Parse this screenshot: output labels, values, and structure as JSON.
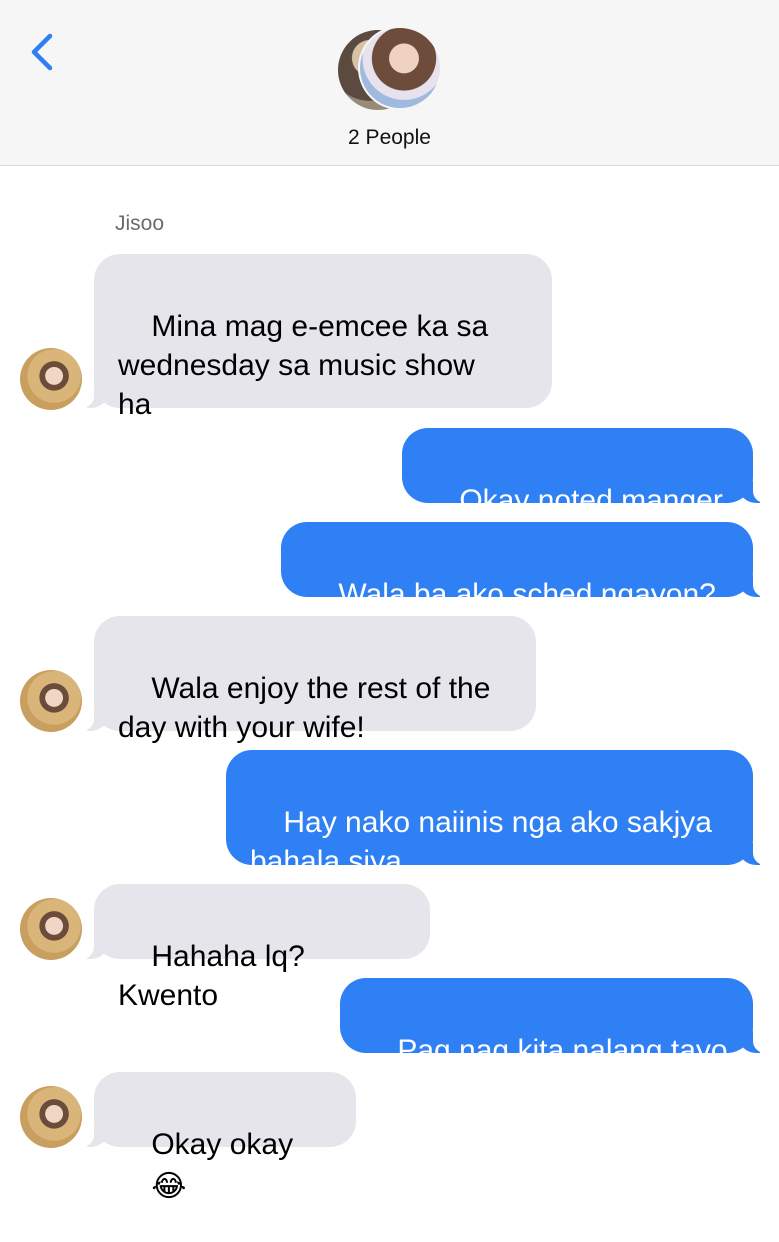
{
  "header": {
    "title": "2 People",
    "back_icon": "chevron-left-icon",
    "accent_color": "#2f80f4"
  },
  "thread": {
    "sender_name": "Jisoo",
    "messages": [
      {
        "direction": "in",
        "text": "Mina mag e-emcee ka sa\nwednesday sa music show\nha"
      },
      {
        "direction": "out",
        "text": "Okay noted manger"
      },
      {
        "direction": "out",
        "text": "Wala ba ako sched ngayon?"
      },
      {
        "direction": "in",
        "text": "Wala enjoy the rest of the\nday with your wife!"
      },
      {
        "direction": "out",
        "text": "Hay nako naiinis nga ako sakjya\nbahala siya"
      },
      {
        "direction": "in",
        "text": "Hahaha lq? Kwento"
      },
      {
        "direction": "out",
        "text": "Pag nag kita nalang tayo"
      },
      {
        "direction": "in",
        "text": "Okay okay",
        "emoji": "😂",
        "emoji_name": "face-with-tears-of-joy-icon"
      }
    ]
  },
  "colors": {
    "incoming_bubble": "#e6e5eb",
    "outgoing_bubble": "#2f80f4",
    "header_bg": "#f6f6f6"
  }
}
